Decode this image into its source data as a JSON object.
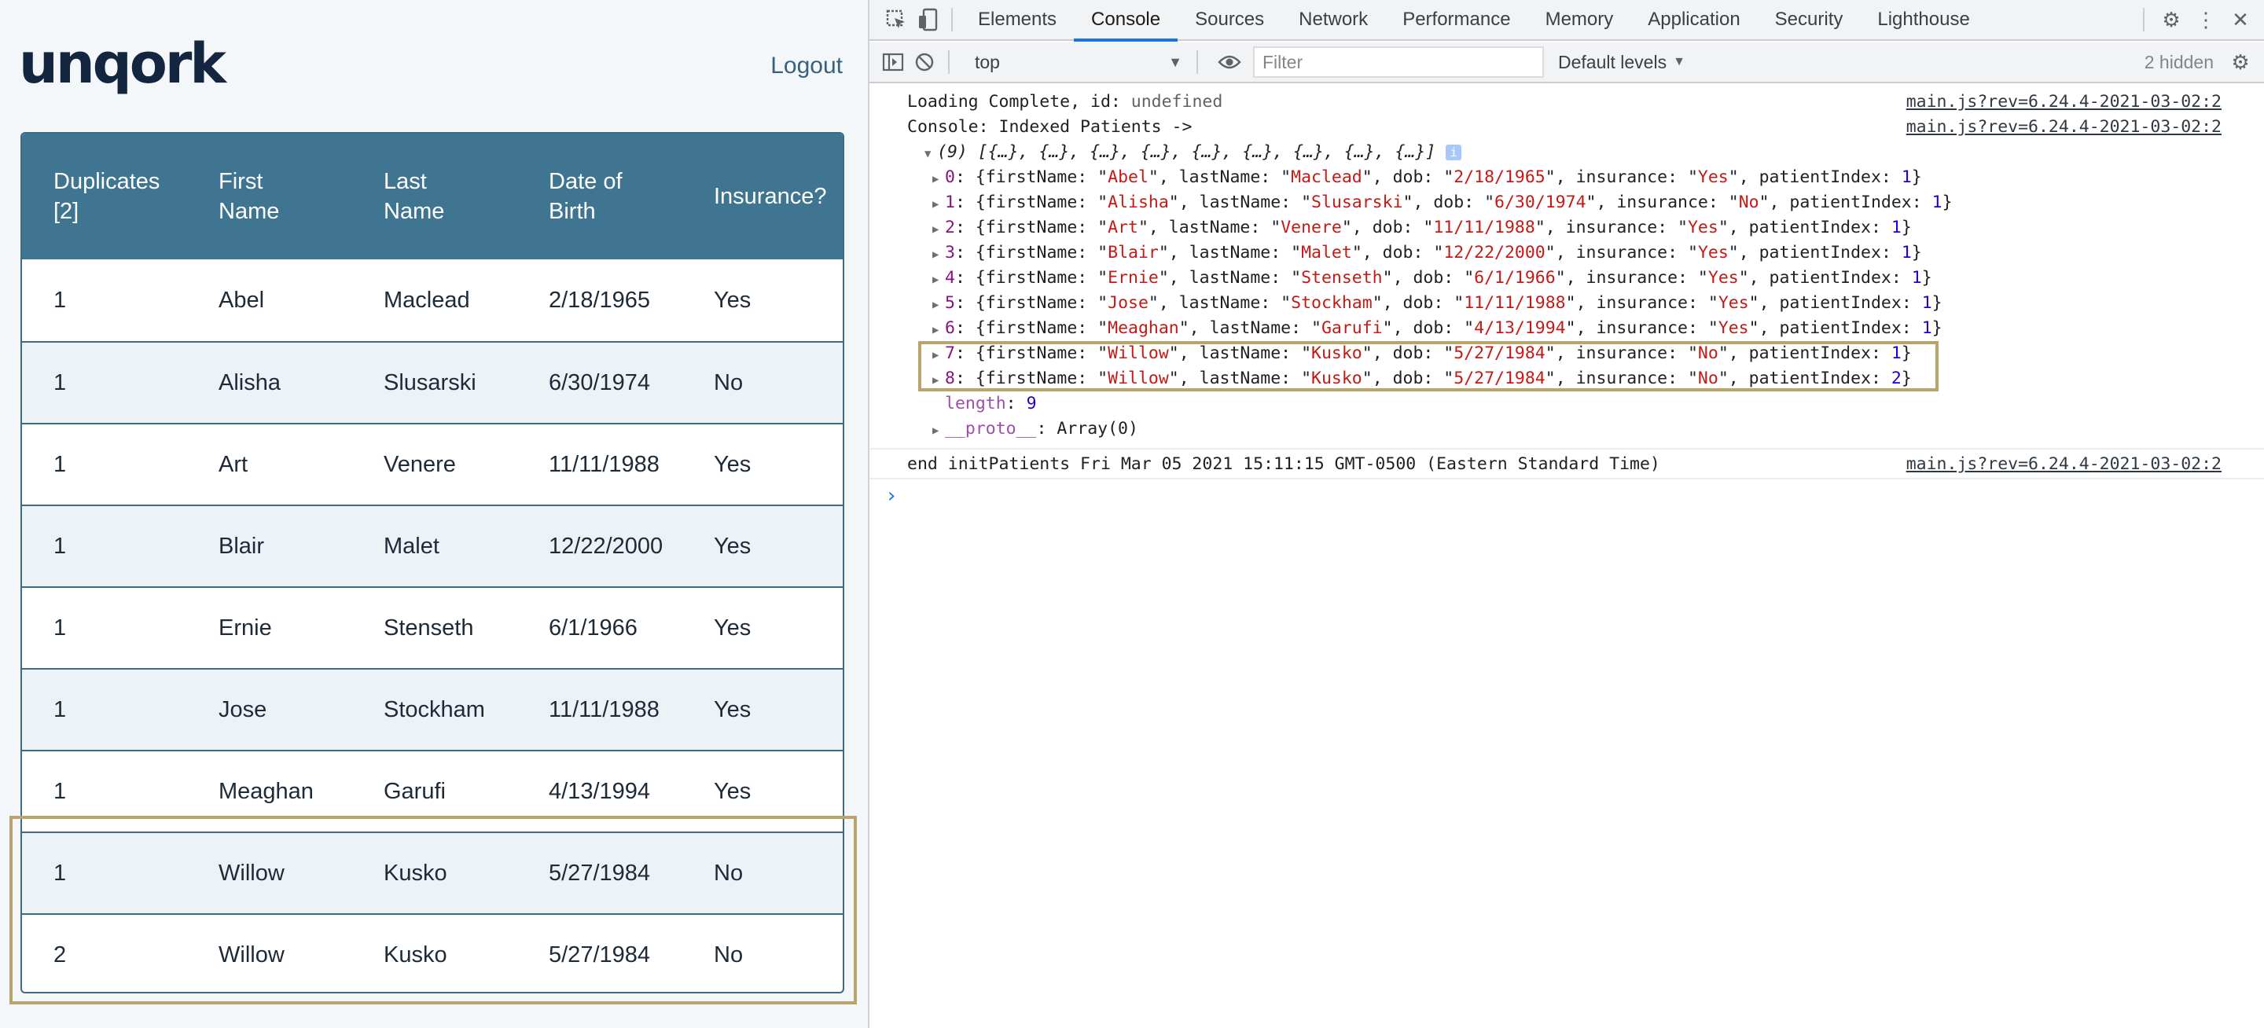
{
  "app": {
    "logo": "unqork",
    "logout": "Logout",
    "table": {
      "headers": [
        [
          "Duplicates",
          "[2]"
        ],
        [
          "First",
          "Name"
        ],
        [
          "Last",
          "Name"
        ],
        [
          "Date of",
          "Birth"
        ],
        [
          "Insurance?",
          ""
        ]
      ],
      "rows": [
        [
          "1",
          "Abel",
          "Maclead",
          "2/18/1965",
          "Yes"
        ],
        [
          "1",
          "Alisha",
          "Slusarski",
          "6/30/1974",
          "No"
        ],
        [
          "1",
          "Art",
          "Venere",
          "11/11/1988",
          "Yes"
        ],
        [
          "1",
          "Blair",
          "Malet",
          "12/22/2000",
          "Yes"
        ],
        [
          "1",
          "Ernie",
          "Stenseth",
          "6/1/1966",
          "Yes"
        ],
        [
          "1",
          "Jose",
          "Stockham",
          "11/11/1988",
          "Yes"
        ],
        [
          "1",
          "Meaghan",
          "Garufi",
          "4/13/1994",
          "Yes"
        ],
        [
          "1",
          "Willow",
          "Kusko",
          "5/27/1984",
          "No"
        ],
        [
          "2",
          "Willow",
          "Kusko",
          "5/27/1984",
          "No"
        ]
      ]
    }
  },
  "devtools": {
    "tabs": [
      "Elements",
      "Console",
      "Sources",
      "Network",
      "Performance",
      "Memory",
      "Application",
      "Security",
      "Lighthouse"
    ],
    "active_tab": "Console",
    "context": "top",
    "filter_placeholder": "Filter",
    "levels": "Default levels",
    "hidden_count": "2 hidden",
    "source": "main.js?rev=6.24.4-2021-03-02:2",
    "lines": {
      "loading": "Loading Complete, id: ",
      "loading_val": "undefined",
      "indexed": "Console: Indexed Patients ->",
      "array_summary": "(9) [{…}, {…}, {…}, {…}, {…}, {…}, {…}, {…}, {…}]",
      "length_key": "length",
      "length_val": "9",
      "proto_key": "__proto__",
      "proto_val": "Array(0)",
      "end": "end initPatients Fri Mar 05 2021 15:11:15 GMT-0500 (Eastern Standard Time)"
    },
    "patients": [
      {
        "idx": "0",
        "first": "Abel",
        "last": "Maclead",
        "dob": "2/18/1965",
        "ins": "Yes",
        "pi": "1"
      },
      {
        "idx": "1",
        "first": "Alisha",
        "last": "Slusarski",
        "dob": "6/30/1974",
        "ins": "No",
        "pi": "1"
      },
      {
        "idx": "2",
        "first": "Art",
        "last": "Venere",
        "dob": "11/11/1988",
        "ins": "Yes",
        "pi": "1"
      },
      {
        "idx": "3",
        "first": "Blair",
        "last": "Malet",
        "dob": "12/22/2000",
        "ins": "Yes",
        "pi": "1"
      },
      {
        "idx": "4",
        "first": "Ernie",
        "last": "Stenseth",
        "dob": "6/1/1966",
        "ins": "Yes",
        "pi": "1"
      },
      {
        "idx": "5",
        "first": "Jose",
        "last": "Stockham",
        "dob": "11/11/1988",
        "ins": "Yes",
        "pi": "1"
      },
      {
        "idx": "6",
        "first": "Meaghan",
        "last": "Garufi",
        "dob": "4/13/1994",
        "ins": "Yes",
        "pi": "1"
      },
      {
        "idx": "7",
        "first": "Willow",
        "last": "Kusko",
        "dob": "5/27/1984",
        "ins": "No",
        "pi": "1"
      },
      {
        "idx": "8",
        "first": "Willow",
        "last": "Kusko",
        "dob": "5/27/1984",
        "ins": "No",
        "pi": "2"
      }
    ]
  },
  "colors": {
    "header_bg": "#3f7590",
    "highlight": "#b9a46c",
    "accent": "#1a73e8"
  }
}
